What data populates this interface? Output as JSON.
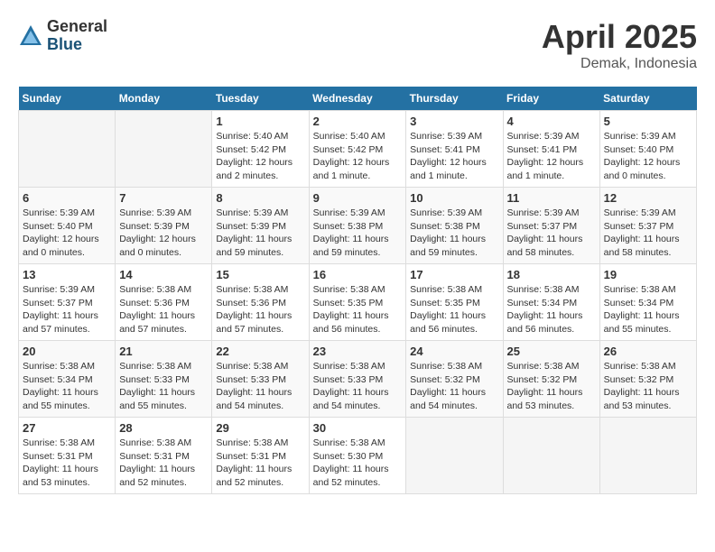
{
  "header": {
    "logo_general": "General",
    "logo_blue": "Blue",
    "month_title": "April 2025",
    "location": "Demak, Indonesia"
  },
  "calendar": {
    "days_of_week": [
      "Sunday",
      "Monday",
      "Tuesday",
      "Wednesday",
      "Thursday",
      "Friday",
      "Saturday"
    ],
    "weeks": [
      [
        {
          "day": "",
          "info": ""
        },
        {
          "day": "",
          "info": ""
        },
        {
          "day": "1",
          "info": "Sunrise: 5:40 AM\nSunset: 5:42 PM\nDaylight: 12 hours and 2 minutes."
        },
        {
          "day": "2",
          "info": "Sunrise: 5:40 AM\nSunset: 5:42 PM\nDaylight: 12 hours and 1 minute."
        },
        {
          "day": "3",
          "info": "Sunrise: 5:39 AM\nSunset: 5:41 PM\nDaylight: 12 hours and 1 minute."
        },
        {
          "day": "4",
          "info": "Sunrise: 5:39 AM\nSunset: 5:41 PM\nDaylight: 12 hours and 1 minute."
        },
        {
          "day": "5",
          "info": "Sunrise: 5:39 AM\nSunset: 5:40 PM\nDaylight: 12 hours and 0 minutes."
        }
      ],
      [
        {
          "day": "6",
          "info": "Sunrise: 5:39 AM\nSunset: 5:40 PM\nDaylight: 12 hours and 0 minutes."
        },
        {
          "day": "7",
          "info": "Sunrise: 5:39 AM\nSunset: 5:39 PM\nDaylight: 12 hours and 0 minutes."
        },
        {
          "day": "8",
          "info": "Sunrise: 5:39 AM\nSunset: 5:39 PM\nDaylight: 11 hours and 59 minutes."
        },
        {
          "day": "9",
          "info": "Sunrise: 5:39 AM\nSunset: 5:38 PM\nDaylight: 11 hours and 59 minutes."
        },
        {
          "day": "10",
          "info": "Sunrise: 5:39 AM\nSunset: 5:38 PM\nDaylight: 11 hours and 59 minutes."
        },
        {
          "day": "11",
          "info": "Sunrise: 5:39 AM\nSunset: 5:37 PM\nDaylight: 11 hours and 58 minutes."
        },
        {
          "day": "12",
          "info": "Sunrise: 5:39 AM\nSunset: 5:37 PM\nDaylight: 11 hours and 58 minutes."
        }
      ],
      [
        {
          "day": "13",
          "info": "Sunrise: 5:39 AM\nSunset: 5:37 PM\nDaylight: 11 hours and 57 minutes."
        },
        {
          "day": "14",
          "info": "Sunrise: 5:38 AM\nSunset: 5:36 PM\nDaylight: 11 hours and 57 minutes."
        },
        {
          "day": "15",
          "info": "Sunrise: 5:38 AM\nSunset: 5:36 PM\nDaylight: 11 hours and 57 minutes."
        },
        {
          "day": "16",
          "info": "Sunrise: 5:38 AM\nSunset: 5:35 PM\nDaylight: 11 hours and 56 minutes."
        },
        {
          "day": "17",
          "info": "Sunrise: 5:38 AM\nSunset: 5:35 PM\nDaylight: 11 hours and 56 minutes."
        },
        {
          "day": "18",
          "info": "Sunrise: 5:38 AM\nSunset: 5:34 PM\nDaylight: 11 hours and 56 minutes."
        },
        {
          "day": "19",
          "info": "Sunrise: 5:38 AM\nSunset: 5:34 PM\nDaylight: 11 hours and 55 minutes."
        }
      ],
      [
        {
          "day": "20",
          "info": "Sunrise: 5:38 AM\nSunset: 5:34 PM\nDaylight: 11 hours and 55 minutes."
        },
        {
          "day": "21",
          "info": "Sunrise: 5:38 AM\nSunset: 5:33 PM\nDaylight: 11 hours and 55 minutes."
        },
        {
          "day": "22",
          "info": "Sunrise: 5:38 AM\nSunset: 5:33 PM\nDaylight: 11 hours and 54 minutes."
        },
        {
          "day": "23",
          "info": "Sunrise: 5:38 AM\nSunset: 5:33 PM\nDaylight: 11 hours and 54 minutes."
        },
        {
          "day": "24",
          "info": "Sunrise: 5:38 AM\nSunset: 5:32 PM\nDaylight: 11 hours and 54 minutes."
        },
        {
          "day": "25",
          "info": "Sunrise: 5:38 AM\nSunset: 5:32 PM\nDaylight: 11 hours and 53 minutes."
        },
        {
          "day": "26",
          "info": "Sunrise: 5:38 AM\nSunset: 5:32 PM\nDaylight: 11 hours and 53 minutes."
        }
      ],
      [
        {
          "day": "27",
          "info": "Sunrise: 5:38 AM\nSunset: 5:31 PM\nDaylight: 11 hours and 53 minutes."
        },
        {
          "day": "28",
          "info": "Sunrise: 5:38 AM\nSunset: 5:31 PM\nDaylight: 11 hours and 52 minutes."
        },
        {
          "day": "29",
          "info": "Sunrise: 5:38 AM\nSunset: 5:31 PM\nDaylight: 11 hours and 52 minutes."
        },
        {
          "day": "30",
          "info": "Sunrise: 5:38 AM\nSunset: 5:30 PM\nDaylight: 11 hours and 52 minutes."
        },
        {
          "day": "",
          "info": ""
        },
        {
          "day": "",
          "info": ""
        },
        {
          "day": "",
          "info": ""
        }
      ]
    ]
  }
}
